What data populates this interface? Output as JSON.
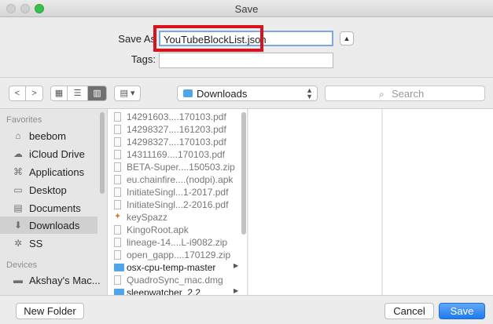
{
  "window": {
    "title": "Save"
  },
  "form": {
    "save_as_label": "Save As",
    "filename": "YouTubeBlockList.json",
    "tags_label": "Tags:",
    "tags_value": ""
  },
  "toolbar": {
    "location": "Downloads",
    "search_placeholder": "Search"
  },
  "sidebar": {
    "favorites_heading": "Favorites",
    "favorites": [
      {
        "label": "beebom",
        "icon": "home-icon"
      },
      {
        "label": "iCloud Drive",
        "icon": "cloud-icon"
      },
      {
        "label": "Applications",
        "icon": "applications-icon"
      },
      {
        "label": "Desktop",
        "icon": "desktop-icon"
      },
      {
        "label": "Documents",
        "icon": "documents-icon"
      },
      {
        "label": "Downloads",
        "icon": "downloads-icon",
        "selected": true
      },
      {
        "label": "SS",
        "icon": "gear-icon"
      }
    ],
    "devices_heading": "Devices",
    "devices": [
      {
        "label": "Akshay's Mac...",
        "icon": "laptop-icon"
      }
    ]
  },
  "files": [
    {
      "name": "14291603....170103.pdf",
      "kind": "file"
    },
    {
      "name": "14298327....161203.pdf",
      "kind": "file"
    },
    {
      "name": "14298327....170103.pdf",
      "kind": "file"
    },
    {
      "name": "14311169....170103.pdf",
      "kind": "file"
    },
    {
      "name": "BETA-Super....150503.zip",
      "kind": "file"
    },
    {
      "name": "eu.chainfire....(nodpi).apk",
      "kind": "file"
    },
    {
      "name": "InitiateSingl...1-2017.pdf",
      "kind": "file"
    },
    {
      "name": "InitiateSingl...2-2016.pdf",
      "kind": "file"
    },
    {
      "name": "keySpazz",
      "kind": "app"
    },
    {
      "name": "KingoRoot.apk",
      "kind": "file"
    },
    {
      "name": "lineage-14....L-i9082.zip",
      "kind": "file"
    },
    {
      "name": "open_gapp....170129.zip",
      "kind": "file"
    },
    {
      "name": "osx-cpu-temp-master",
      "kind": "folder"
    },
    {
      "name": "QuadroSync_mac.dmg",
      "kind": "file"
    },
    {
      "name": "sleepwatcher_2.2",
      "kind": "folder"
    }
  ],
  "footer": {
    "new_folder": "New Folder",
    "cancel": "Cancel",
    "save": "Save"
  }
}
